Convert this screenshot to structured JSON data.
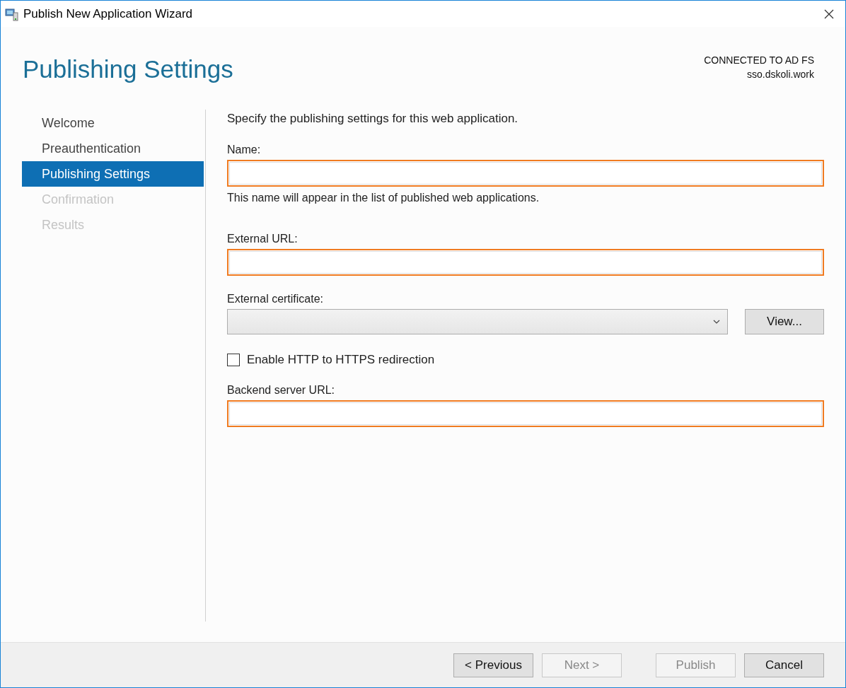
{
  "window": {
    "title": "Publish New Application Wizard"
  },
  "page_title": "Publishing Settings",
  "connection": {
    "status": "CONNECTED TO AD FS",
    "server": "sso.dskoli.work"
  },
  "steps": [
    {
      "label": "Welcome",
      "selected": false,
      "disabled": false
    },
    {
      "label": "Preauthentication",
      "selected": false,
      "disabled": false
    },
    {
      "label": "Publishing Settings",
      "selected": true,
      "disabled": false
    },
    {
      "label": "Confirmation",
      "selected": false,
      "disabled": true
    },
    {
      "label": "Results",
      "selected": false,
      "disabled": true
    }
  ],
  "intro": "Specify the publishing settings for this web application.",
  "fields": [
    {
      "kind": "text",
      "label": "Name:",
      "invalid": true,
      "hint": "This name will appear in the list of published web applications."
    },
    {
      "kind": "text",
      "label": "External URL:",
      "invalid": true
    },
    {
      "kind": "select",
      "label": "External certificate:",
      "button": "View..."
    },
    {
      "kind": "checkbox",
      "label": "Enable HTTP to HTTPS redirection",
      "checked": false
    },
    {
      "kind": "text",
      "label": "Backend server URL:",
      "invalid": true
    }
  ],
  "buttons": [
    {
      "label": "< Previous",
      "disabled": false
    },
    {
      "label": "Next >",
      "disabled": true
    },
    {
      "label": "Publish",
      "disabled": true
    },
    {
      "label": "Cancel",
      "disabled": false
    }
  ]
}
